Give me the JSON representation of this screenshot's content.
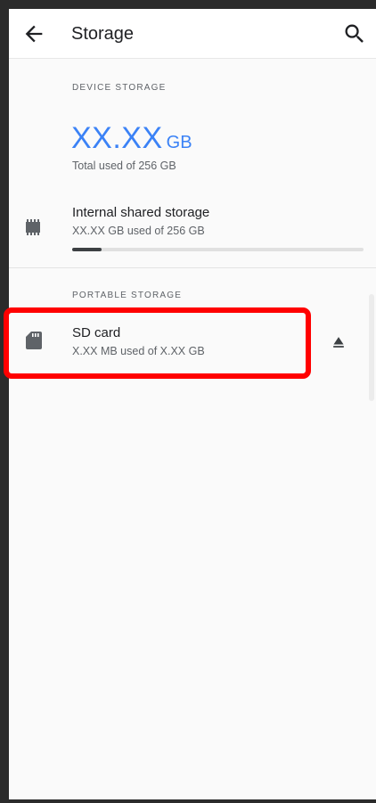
{
  "appbar": {
    "title": "Storage",
    "back_icon": "arrow-back-icon",
    "search_icon": "search-icon"
  },
  "device_storage": {
    "header": "DEVICE STORAGE",
    "used_value": "XX.XX",
    "used_unit": "GB",
    "total_text": "Total used of 256 GB",
    "internal": {
      "icon": "memory-chip-icon",
      "title": "Internal shared storage",
      "subtitle": "XX.XX GB used of 256 GB",
      "progress_fraction": 0.1
    }
  },
  "portable_storage": {
    "header": "PORTABLE STORAGE",
    "sd_card": {
      "icon": "sd-card-icon",
      "title": "SD card",
      "subtitle": "X.XX MB used of X.XX GB",
      "action_icon": "eject-icon"
    }
  },
  "colors": {
    "accent": "#3b82f6",
    "highlight": "#ff0000",
    "progress": "#3c4043"
  }
}
